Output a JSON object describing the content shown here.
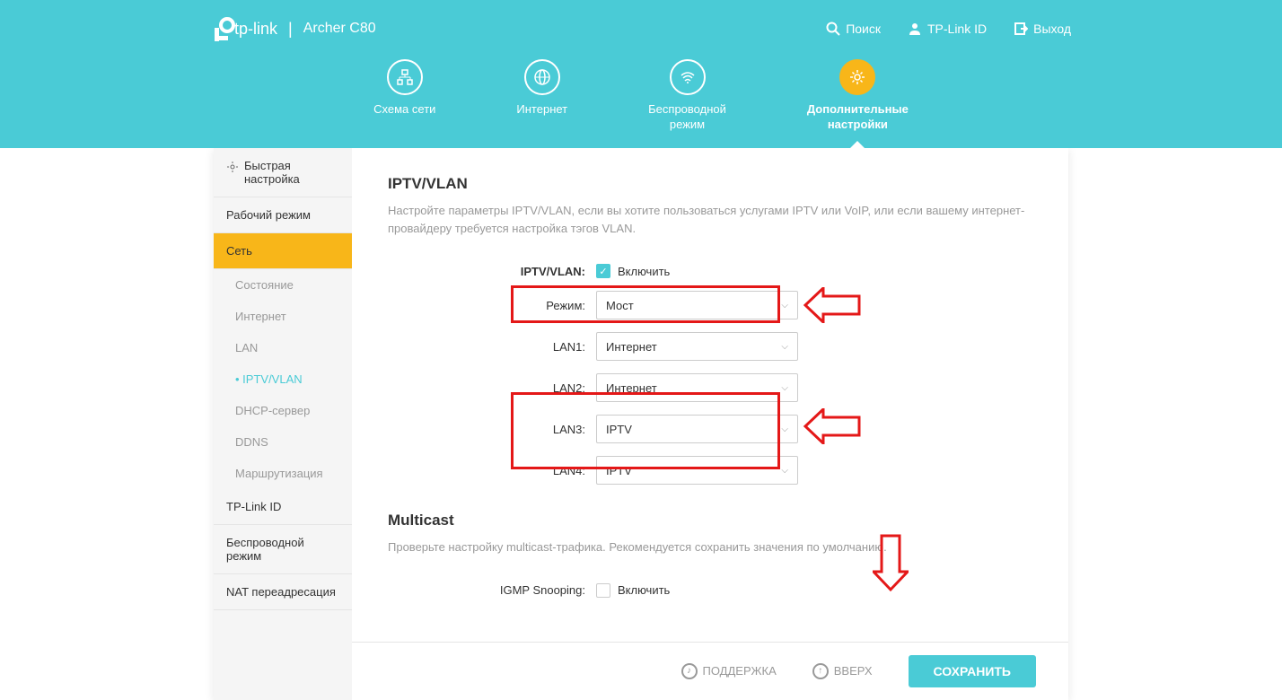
{
  "header": {
    "brand": "tp-link",
    "model": "Archer C80",
    "links": {
      "search": "Поиск",
      "tplink_id": "TP-Link ID",
      "logout": "Выход"
    }
  },
  "nav": {
    "tabs": [
      {
        "label": "Схема сети"
      },
      {
        "label": "Интернет"
      },
      {
        "label": "Беспроводной\nрежим"
      },
      {
        "label": "Дополнительные\nнастройки"
      }
    ]
  },
  "sidebar": {
    "items": [
      {
        "label": "Быстрая настройка"
      },
      {
        "label": "Рабочий режим"
      },
      {
        "label": "Сеть"
      },
      {
        "label": "Состояние"
      },
      {
        "label": "Интернет"
      },
      {
        "label": "LAN"
      },
      {
        "label": "IPTV/VLAN"
      },
      {
        "label": "DHCP-сервер"
      },
      {
        "label": "DDNS"
      },
      {
        "label": "Маршрутизация"
      },
      {
        "label": "TP-Link ID"
      },
      {
        "label": "Беспроводной режим"
      },
      {
        "label": "NAT переадресация"
      }
    ]
  },
  "content": {
    "iptv": {
      "title": "IPTV/VLAN",
      "desc": "Настройте параметры IPTV/VLAN, если вы хотите пользоваться услугами IPTV или VoIP, или если вашему интернет-провайдеру требуется настройка тэгов VLAN.",
      "enable_label": "IPTV/VLAN:",
      "enable_check": "Включить",
      "mode_label": "Режим:",
      "mode_value": "Мост",
      "lan1_label": "LAN1:",
      "lan1_value": "Интернет",
      "lan2_label": "LAN2:",
      "lan2_value": "Интернет",
      "lan3_label": "LAN3:",
      "lan3_value": "IPTV",
      "lan4_label": "LAN4:",
      "lan4_value": "IPTV"
    },
    "multicast": {
      "title": "Multicast",
      "desc": "Проверьте настройку multicast-трафика. Рекомендуется сохранить значения по умолчанию.",
      "igmp_label": "IGMP Snooping:",
      "igmp_check": "Включить"
    }
  },
  "footer": {
    "support": "ПОДДЕРЖКА",
    "up": "ВВЕРХ",
    "save": "СОХРАНИТЬ"
  }
}
